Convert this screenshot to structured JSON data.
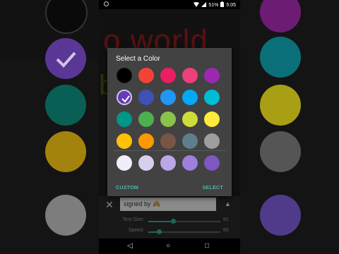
{
  "status_bar": {
    "battery": "51%",
    "time": "5:05"
  },
  "background": {
    "text_line1": "o world",
    "text_line2": "b"
  },
  "dialog": {
    "title": "Select a Color",
    "selected_color": "#673ab7",
    "grid_colors": [
      [
        "#000000",
        "#f44336",
        "#e91e63",
        "#ec407a",
        "#9c27b0"
      ],
      [
        "#673ab7",
        "#3f51b5",
        "#2196f3",
        "#03a9f4",
        "#00bcd4"
      ],
      [
        "#009688",
        "#4caf50",
        "#8bc34a",
        "#cddc39",
        "#ffeb3b"
      ],
      [
        "#ffc107",
        "#ff9800",
        "#795548",
        "#607d8b",
        "#9e9e9e"
      ]
    ],
    "shade_colors": [
      "#f0eefa",
      "#d8cff0",
      "#bba6e8",
      "#9e7fdd",
      "#7e57c2"
    ],
    "custom_label": "CUSTOM",
    "select_label": "SELECT",
    "accent": "#4db6ac"
  },
  "bottom_panel": {
    "signed_text": "signed by 🙈",
    "rows": [
      {
        "label": "Text Size:",
        "value": "81",
        "fraction": 0.35
      },
      {
        "label": "Speed:",
        "value": "60",
        "fraction": 0.15
      }
    ]
  },
  "icons": {
    "close": "✕",
    "caret_up": "▲",
    "nav_back": "◁",
    "nav_home": "○",
    "nav_recent": "□"
  }
}
